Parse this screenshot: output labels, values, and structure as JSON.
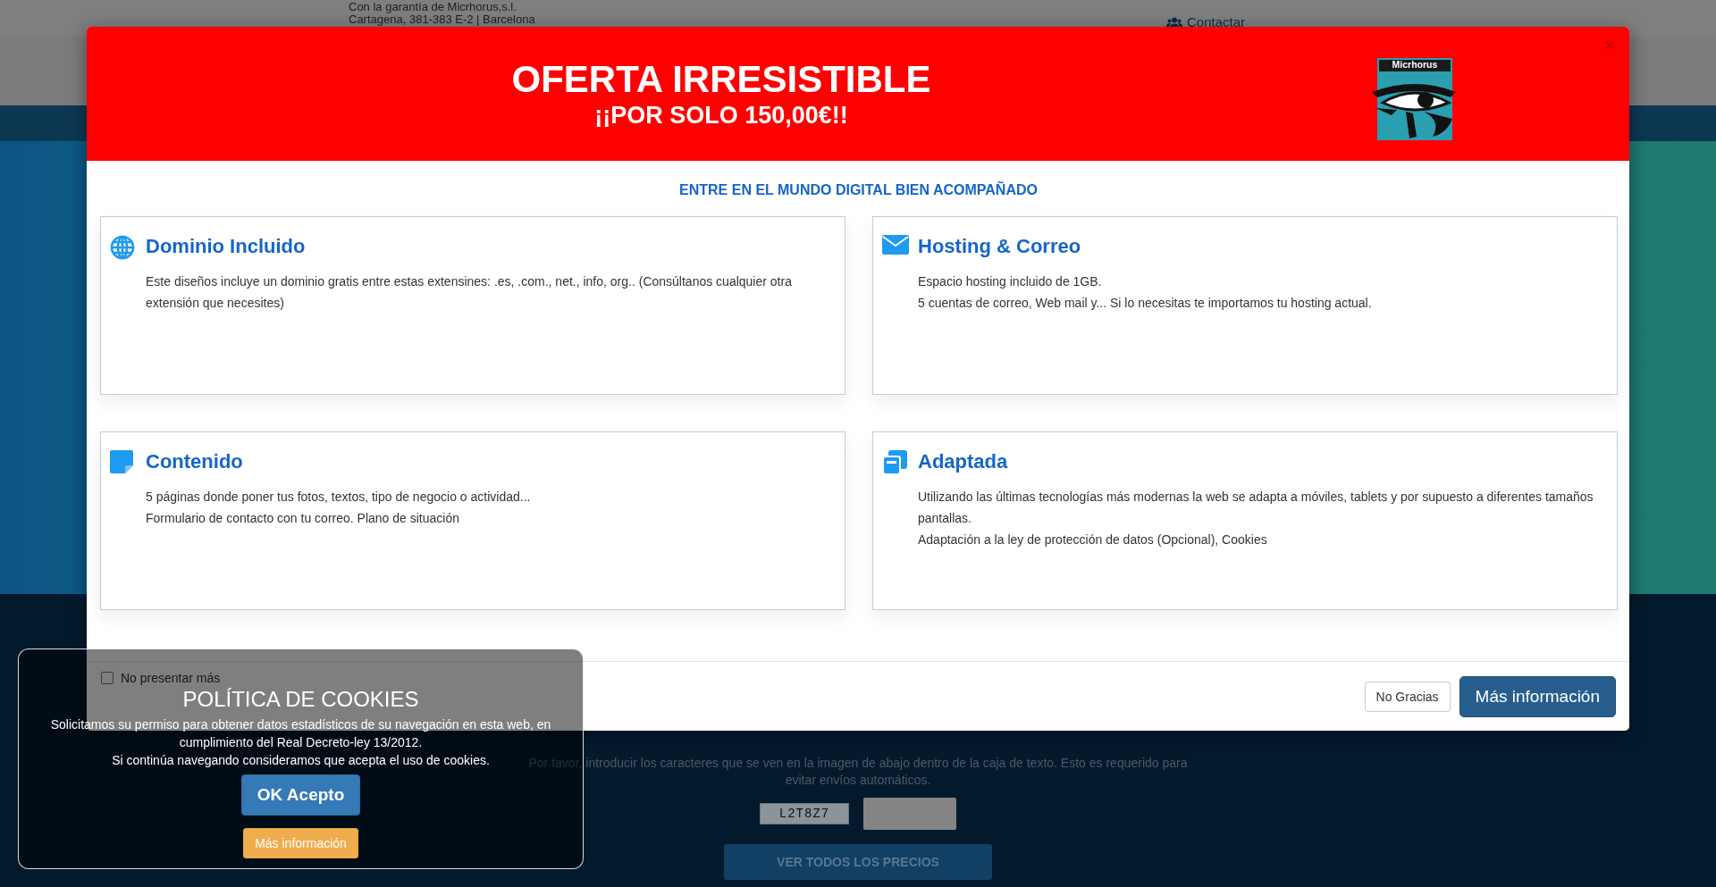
{
  "site": {
    "tagline": "Con la garantía de Micrhorus,s.l.",
    "address": "Cartagena, 381-383 E-2 | Barcelona",
    "contact_link": "Contactar",
    "captcha_hint": "Por favor, introducir los caracteres que se ven en la imagen de abajo dentro de la caja de texto. Esto es requerido para evitar envíos automáticos.",
    "captcha_code": "L2T8Z7",
    "prices_button": "VER TODOS LOS PRECIOS"
  },
  "modal": {
    "title": "OFERTA IRRESISTIBLE",
    "subtitle": "¡¡POR SOLO 150,00€!!",
    "logo_text": "Micrhorus",
    "close": "×",
    "heading": "ENTRE EN EL MUNDO DIGITAL BIEN ACOMPAÑADO",
    "features": [
      {
        "kind": "globe",
        "title": "Dominio Incluido",
        "lines": [
          "Este diseños incluye un dominio gratis entre estas extensines: .es, .com., net., info, org.. (Consúltanos cualquier otra extensión que necesites)"
        ]
      },
      {
        "kind": "mail",
        "title": "Hosting & Correo",
        "lines": [
          "Espacio hosting incluido de 1GB.",
          "5 cuentas de correo, Web mail y... Si lo necesitas te importamos tu hosting actual."
        ]
      },
      {
        "kind": "note",
        "title": "Contenido",
        "lines": [
          "5 páginas donde poner tus fotos, textos, tipo de negocio o actividad...",
          "Formulario de contacto con tu correo. Plano de situación"
        ]
      },
      {
        "kind": "windows",
        "title": "Adaptada",
        "lines": [
          "Utilizando las últimas tecnologías más modernas la web se adapta a móviles, tablets y por supuesto a diferentes tamaños pantallas.",
          "Adaptación a la ley de protección de datos (Opcional), Cookies"
        ]
      }
    ],
    "dont_show": {
      "label": "No presentar más",
      "checked": false
    },
    "buttons": [
      {
        "kind": "secondary",
        "label": "No Gracias"
      },
      {
        "kind": "primary",
        "label": "Más información"
      }
    ]
  },
  "cookies": {
    "title": "POLÍTICA DE COOKIES",
    "paragraphs": [
      "Solicitamos su permiso para obtener datos estadísticos de su navegación en esta web, en cumplimiento del Real Decreto-ley 13/2012.",
      "Si continúa navegando consideramos que acepta el uso de cookies."
    ],
    "accept": "OK Acepto",
    "more": "Más información"
  }
}
